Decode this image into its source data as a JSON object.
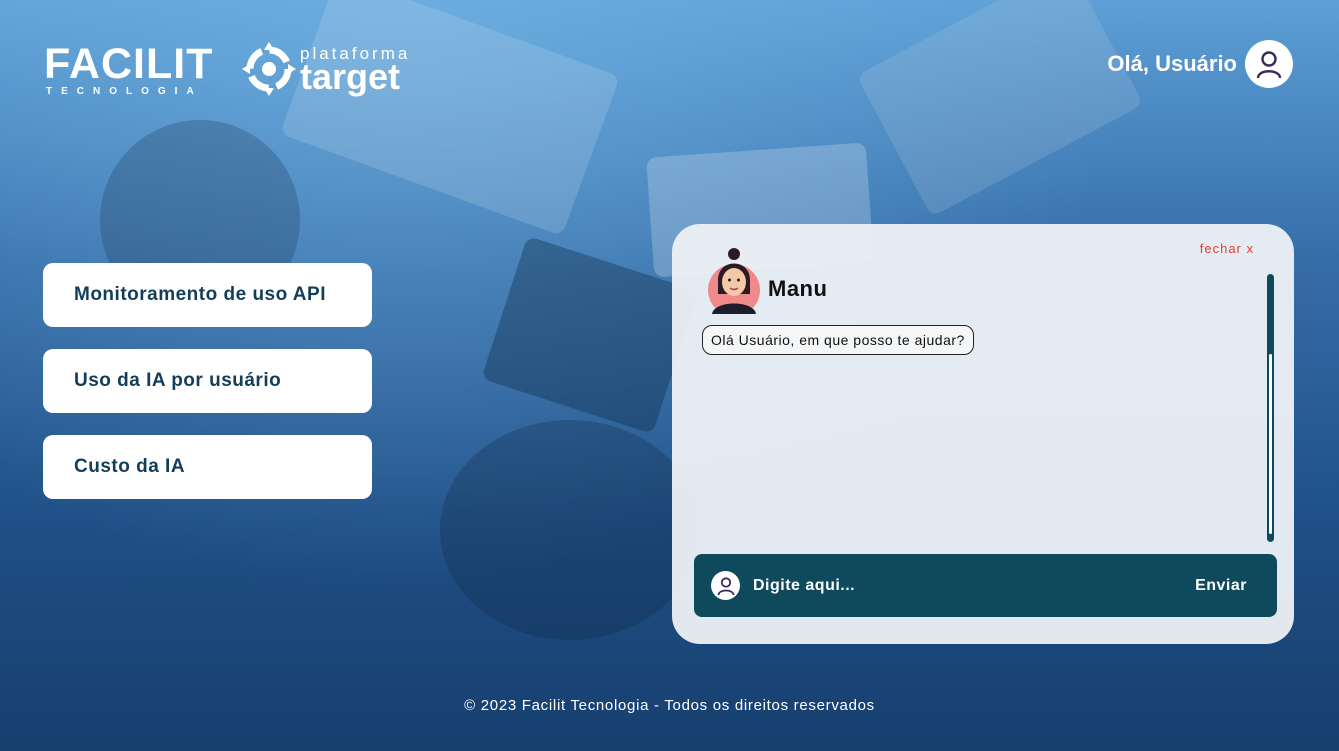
{
  "header": {
    "brand_name": "FACILIT",
    "brand_subtitle": "TECNOLOGIA",
    "product_prefix": "plataforma",
    "product_name": "target",
    "greeting": "Olá, Usuário"
  },
  "menu": [
    {
      "label": "Monitoramento de uso API"
    },
    {
      "label": "Uso da IA por usuário"
    },
    {
      "label": "Custo da IA"
    }
  ],
  "chat": {
    "close_label": "fechar x",
    "bot_name": "Manu",
    "messages": [
      {
        "text": "Olá Usuário, em que posso te ajudar?"
      }
    ],
    "input_placeholder": "Digite aqui...",
    "send_label": "Enviar"
  },
  "footer": {
    "text": "© 2023 Facilit Tecnologia - Todos os direitos reservados"
  },
  "colors": {
    "accent": "#0f4a5c",
    "menu_text": "#133e5a",
    "close_link": "#e0402f"
  },
  "icons": [
    "target-logo-icon",
    "user-avatar-icon",
    "bot-avatar-icon",
    "input-user-icon"
  ]
}
